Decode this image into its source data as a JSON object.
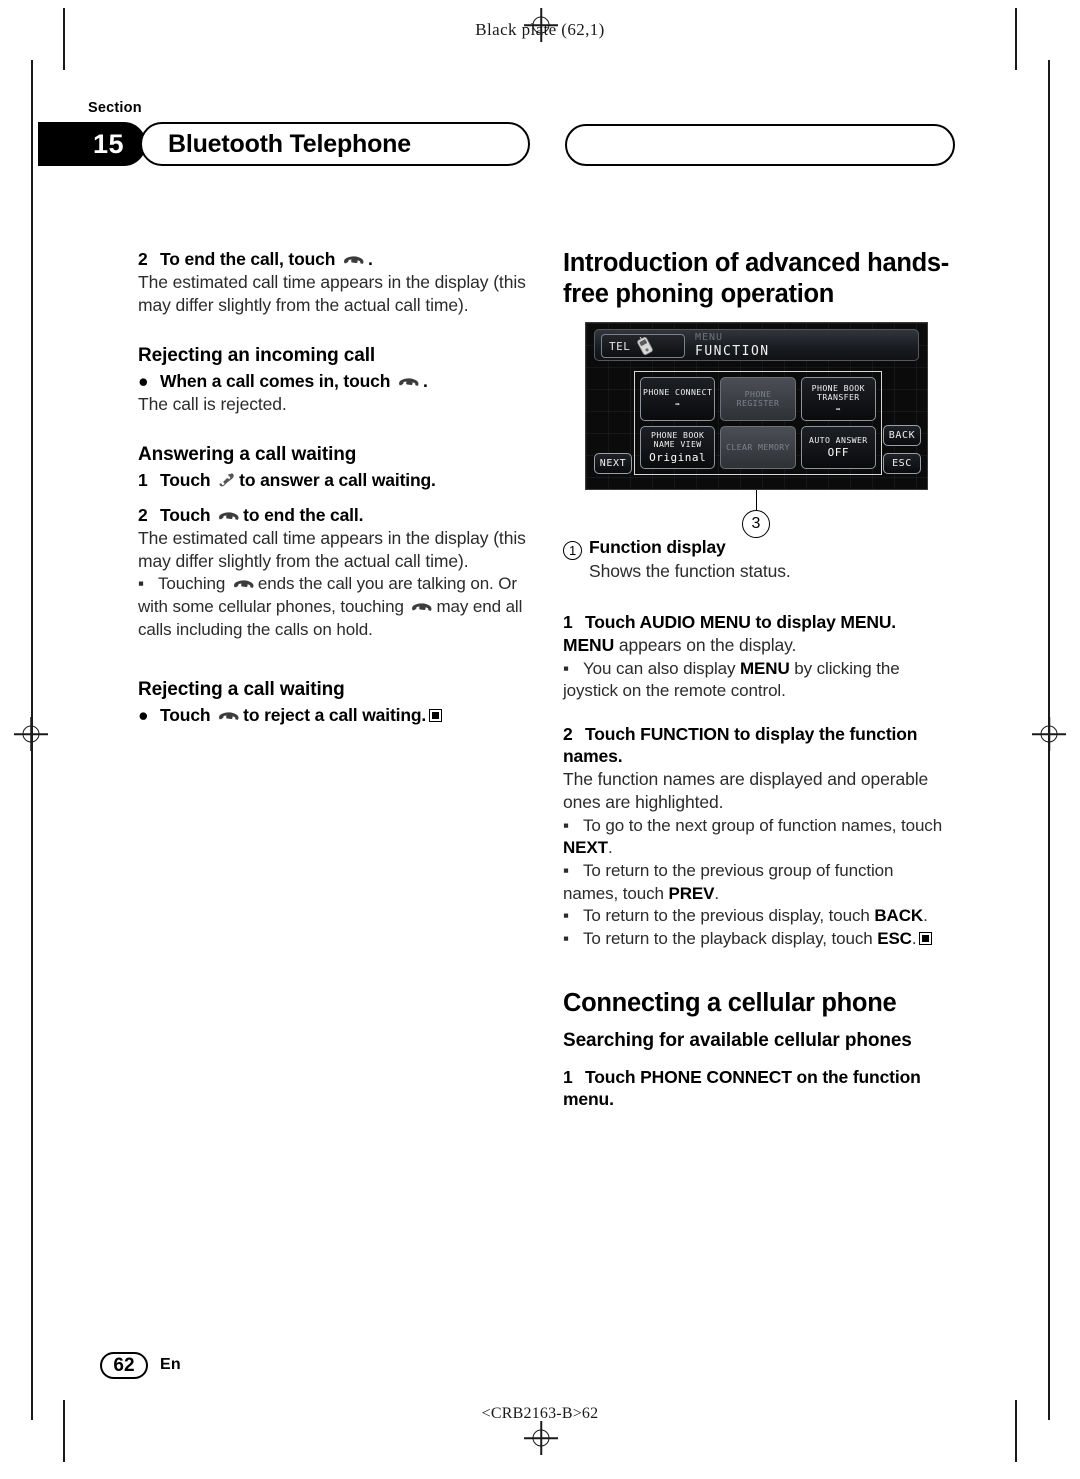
{
  "plate_header": "Black plate (62,1)",
  "section": {
    "label": "Section",
    "number": "15",
    "title": "Bluetooth Telephone"
  },
  "left_column": {
    "step_end_call": {
      "num": "2",
      "text_before": "To end the call, touch",
      "icon": "phone-hangup-icon",
      "text_after": "."
    },
    "estimated_time_note": "The estimated call time appears in the display (this may differ slightly from the actual call time).",
    "rejecting_incoming_heading": "Rejecting an incoming call",
    "reject_bullet": {
      "mark": "●",
      "text_before": "When a call comes in, touch",
      "icon": "phone-hangup-icon",
      "text_after": "."
    },
    "call_rejected_note": "The call is rejected.",
    "answering_waiting_heading": "Answering a call waiting",
    "answer_step_1": {
      "num": "1",
      "text_before": "Touch",
      "icon": "phone-answer-icon",
      "text_after": "to answer a call waiting."
    },
    "answer_step_2": {
      "num": "2",
      "text_before": "Touch",
      "icon": "phone-hangup-icon",
      "text_after": "to end the call."
    },
    "estimated_time_note_2": "The estimated call time appears in the display (this may differ slightly from the actual call time).",
    "touching_note": {
      "mark": "▪",
      "part1": "Touching",
      "icon1": "phone-hangup-icon",
      "part2": "ends the call you are talking on. Or with some cellular phones, touching",
      "icon2": "phone-hangup-icon",
      "part3": "may end all calls including the calls on hold."
    },
    "rejecting_waiting_heading": "Rejecting a call waiting",
    "reject_waiting_bullet": {
      "mark": "●",
      "text_before": "Touch",
      "icon": "phone-hangup-icon",
      "text_after": "to reject a call waiting."
    }
  },
  "right_column": {
    "intro_heading": "Introduction of advanced hands-free phoning operation",
    "callout_number": "3",
    "callout_item": {
      "number": "1",
      "circled": "①",
      "label": "Function display",
      "description": "Shows the function status."
    },
    "step_1": {
      "num": "1",
      "text": "Touch AUDIO MENU to display MENU."
    },
    "step_1_note_before": "",
    "step_1_note_bold": "MENU",
    "step_1_note_after": " appears on the display.",
    "joystick_note": {
      "mark": "▪",
      "part1": "You can also display ",
      "bold": "MENU",
      "part2": " by clicking the joystick on the remote control."
    },
    "step_2": {
      "num": "2",
      "text": "Touch FUNCTION to display the function names."
    },
    "step_2_note": "The function names are displayed and operable ones are highlighted.",
    "notes": [
      {
        "mark": "▪",
        "part1": "To go to the next group of function names, touch ",
        "bold": "NEXT",
        "part2": "."
      },
      {
        "mark": "▪",
        "part1": "To return to the previous group of function names, touch ",
        "bold": "PREV",
        "part2": "."
      },
      {
        "mark": "▪",
        "part1": "To return to the previous display, touch ",
        "bold": "BACK",
        "part2": "."
      },
      {
        "mark": "▪",
        "part1": "To return to the playback display, touch ",
        "bold": "ESC",
        "part2": "."
      }
    ],
    "connecting_heading": "Connecting a cellular phone",
    "searching_heading": "Searching for available cellular phones",
    "connect_step_1": {
      "num": "1",
      "text": "Touch PHONE CONNECT on the function menu."
    }
  },
  "device_screen": {
    "tel_label": "TEL",
    "phone_icon": "cellphone-icon",
    "menu_label": "MENU",
    "function_label": "FUNCTION",
    "buttons": [
      {
        "name": "PHONE CONNECT",
        "value": "",
        "arrow": "➡",
        "state": "active"
      },
      {
        "name": "PHONE REGISTER",
        "value": "",
        "arrow": "",
        "state": "dim"
      },
      {
        "name": "PHONE BOOK TRANSFER",
        "value": "",
        "arrow": "➡",
        "state": "active"
      },
      {
        "name": "PHONE BOOK NAME VIEW",
        "value": "Original",
        "arrow": "",
        "state": "active"
      },
      {
        "name": "CLEAR MEMORY",
        "value": "",
        "arrow": "",
        "state": "dim"
      },
      {
        "name": "AUTO ANSWER",
        "value": "OFF",
        "arrow": "",
        "state": "active"
      }
    ],
    "next_label": "NEXT",
    "back_label": "BACK",
    "esc_label": "ESC"
  },
  "footer": {
    "page_number": "62",
    "language": "En",
    "doc_code": "<CRB2163-B>62"
  }
}
